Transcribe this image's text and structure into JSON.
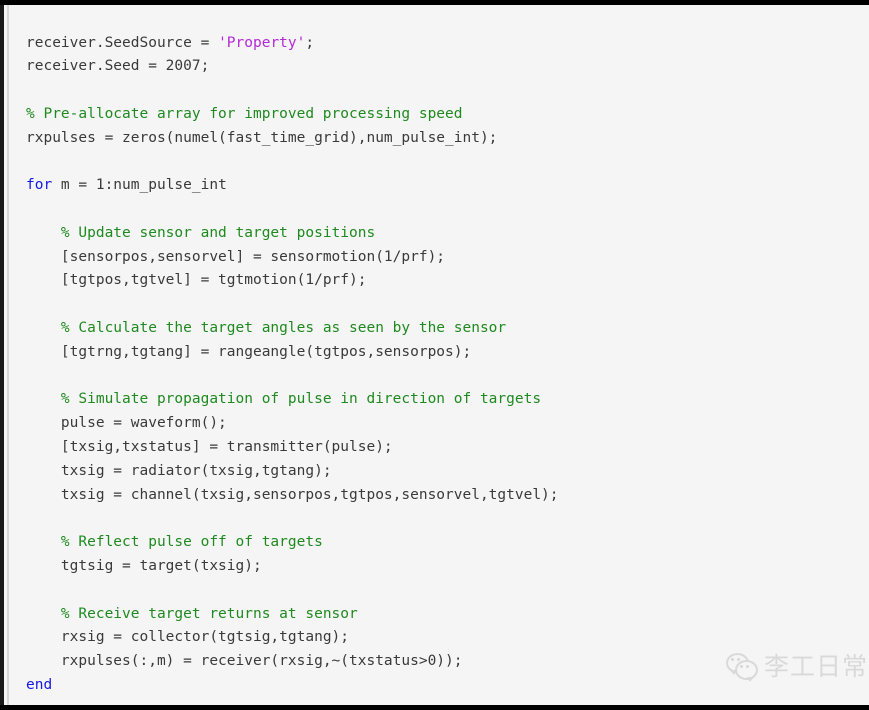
{
  "code_block": {
    "language": "matlab",
    "colors": {
      "background": "#f5f5f5",
      "plain": "#3a3a3a",
      "comment": "#1f8a1f",
      "keyword": "#1616e8",
      "string": "#b429d6",
      "border_accent": "#1a1a1a",
      "frame": "#000000"
    },
    "lines": [
      {
        "indent": 0,
        "tokens": [
          {
            "t": "plain",
            "s": "receiver.SeedSource = "
          },
          {
            "t": "string",
            "s": "'Property'"
          },
          {
            "t": "plain",
            "s": ";"
          }
        ]
      },
      {
        "indent": 0,
        "tokens": [
          {
            "t": "plain",
            "s": "receiver.Seed = 2007;"
          }
        ]
      },
      {
        "indent": 0,
        "tokens": []
      },
      {
        "indent": 0,
        "tokens": [
          {
            "t": "comment",
            "s": "% Pre-allocate array for improved processing speed"
          }
        ]
      },
      {
        "indent": 0,
        "tokens": [
          {
            "t": "plain",
            "s": "rxpulses = zeros(numel(fast_time_grid),num_pulse_int);"
          }
        ]
      },
      {
        "indent": 0,
        "tokens": []
      },
      {
        "indent": 0,
        "tokens": [
          {
            "t": "keyword",
            "s": "for"
          },
          {
            "t": "plain",
            "s": " m = 1:num_pulse_int"
          }
        ]
      },
      {
        "indent": 0,
        "tokens": []
      },
      {
        "indent": 1,
        "tokens": [
          {
            "t": "comment",
            "s": "% Update sensor and target positions"
          }
        ]
      },
      {
        "indent": 1,
        "tokens": [
          {
            "t": "plain",
            "s": "[sensorpos,sensorvel] = sensormotion(1/prf);"
          }
        ]
      },
      {
        "indent": 1,
        "tokens": [
          {
            "t": "plain",
            "s": "[tgtpos,tgtvel] = tgtmotion(1/prf);"
          }
        ]
      },
      {
        "indent": 0,
        "tokens": []
      },
      {
        "indent": 1,
        "tokens": [
          {
            "t": "comment",
            "s": "% Calculate the target angles as seen by the sensor"
          }
        ]
      },
      {
        "indent": 1,
        "tokens": [
          {
            "t": "plain",
            "s": "[tgtrng,tgtang] = rangeangle(tgtpos,sensorpos);"
          }
        ]
      },
      {
        "indent": 0,
        "tokens": []
      },
      {
        "indent": 1,
        "tokens": [
          {
            "t": "comment",
            "s": "% Simulate propagation of pulse in direction of targets"
          }
        ]
      },
      {
        "indent": 1,
        "tokens": [
          {
            "t": "plain",
            "s": "pulse = waveform();"
          }
        ]
      },
      {
        "indent": 1,
        "tokens": [
          {
            "t": "plain",
            "s": "[txsig,txstatus] = transmitter(pulse);"
          }
        ]
      },
      {
        "indent": 1,
        "tokens": [
          {
            "t": "plain",
            "s": "txsig = radiator(txsig,tgtang);"
          }
        ]
      },
      {
        "indent": 1,
        "tokens": [
          {
            "t": "plain",
            "s": "txsig = channel(txsig,sensorpos,tgtpos,sensorvel,tgtvel);"
          }
        ]
      },
      {
        "indent": 0,
        "tokens": []
      },
      {
        "indent": 1,
        "tokens": [
          {
            "t": "comment",
            "s": "% Reflect pulse off of targets"
          }
        ]
      },
      {
        "indent": 1,
        "tokens": [
          {
            "t": "plain",
            "s": "tgtsig = target(txsig);"
          }
        ]
      },
      {
        "indent": 0,
        "tokens": []
      },
      {
        "indent": 1,
        "tokens": [
          {
            "t": "comment",
            "s": "% Receive target returns at sensor"
          }
        ]
      },
      {
        "indent": 1,
        "tokens": [
          {
            "t": "plain",
            "s": "rxsig = collector(tgtsig,tgtang);"
          }
        ]
      },
      {
        "indent": 1,
        "tokens": [
          {
            "t": "plain",
            "s": "rxpulses(:,m) = receiver(rxsig,~(txstatus>0));"
          }
        ]
      },
      {
        "indent": 0,
        "tokens": [
          {
            "t": "keyword",
            "s": "end"
          }
        ]
      }
    ]
  },
  "watermark": {
    "label": "李工日常",
    "icon": "wechat-icon"
  }
}
